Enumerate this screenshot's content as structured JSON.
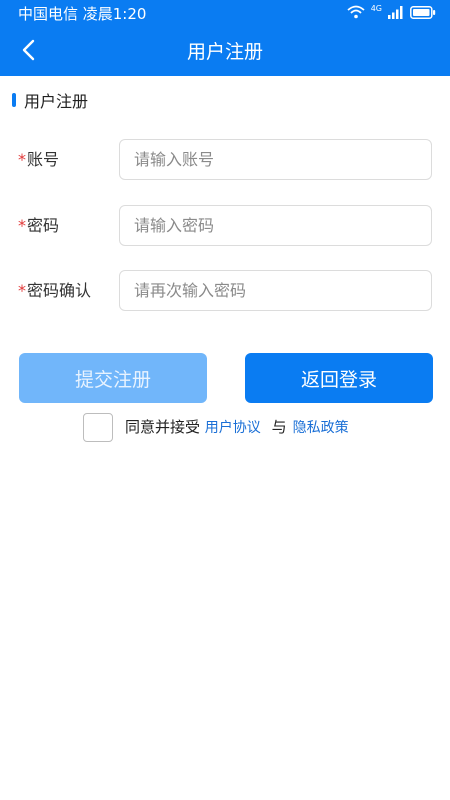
{
  "status_bar": {
    "carrier_time": "中国电信 凌晨1:20",
    "network": "4G",
    "icons": [
      "wifi-icon",
      "signal-icon",
      "battery-icon"
    ]
  },
  "nav": {
    "title": "用户注册",
    "back_icon": "chevron-left-icon"
  },
  "section": {
    "title": "用户注册"
  },
  "form": {
    "fields": [
      {
        "required": "*",
        "label": "账号",
        "placeholder": "请输入账号",
        "value": ""
      },
      {
        "required": "*",
        "label": "密码",
        "placeholder": "请输入密码",
        "value": ""
      },
      {
        "required": "*",
        "label": "密码确认",
        "placeholder": "请再次输入密码",
        "value": ""
      }
    ]
  },
  "buttons": {
    "submit": "提交注册",
    "back_login": "返回登录"
  },
  "agreement": {
    "checked": false,
    "prefix": "同意并接受",
    "user_agreement": "用户协议",
    "and": "与",
    "privacy_policy": "隐私政策"
  },
  "colors": {
    "primary": "#0a7cf2",
    "disabled_button": "#71b6fa",
    "required": "#e23a3a",
    "link": "#1a6fd6"
  }
}
